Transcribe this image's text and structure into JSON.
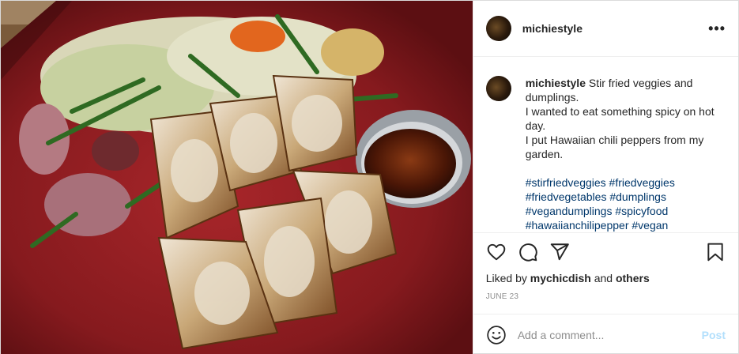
{
  "post": {
    "username": "michiestyle",
    "more_label": "•••",
    "image_alt": "Stir fried veggies and pan-fried dumplings on a red plate with a cup of chili dipping sauce"
  },
  "caption": {
    "username": "michiestyle",
    "lines": [
      "Stir fried veggies and dumplings.",
      "I wanted to eat something spicy on hot day.",
      "I put Hawaiian chili peppers from my garden."
    ],
    "hashtags": [
      "#stirfriedveggies",
      "#friedveggies",
      "#friedvegetables",
      "#dumplings",
      "#vegandumplings",
      "#spicyfood",
      "#hawaiianchilipepper",
      "#vegan"
    ]
  },
  "actions": {
    "like_icon": "heart-icon",
    "comment_icon": "comment-icon",
    "share_icon": "paper-plane-icon",
    "save_icon": "bookmark-icon"
  },
  "likes": {
    "prefix": "Liked by",
    "user": "mychicdish",
    "joiner": "and",
    "others": "others"
  },
  "date": "JUNE 23",
  "comment": {
    "placeholder": "Add a comment...",
    "post_label": "Post",
    "emoji_icon": "smiley-icon"
  },
  "colors": {
    "link": "#00376b",
    "post_button_disabled": "#b2dffc",
    "muted": "#8e8e8e",
    "plate": "#8e1a1a"
  }
}
